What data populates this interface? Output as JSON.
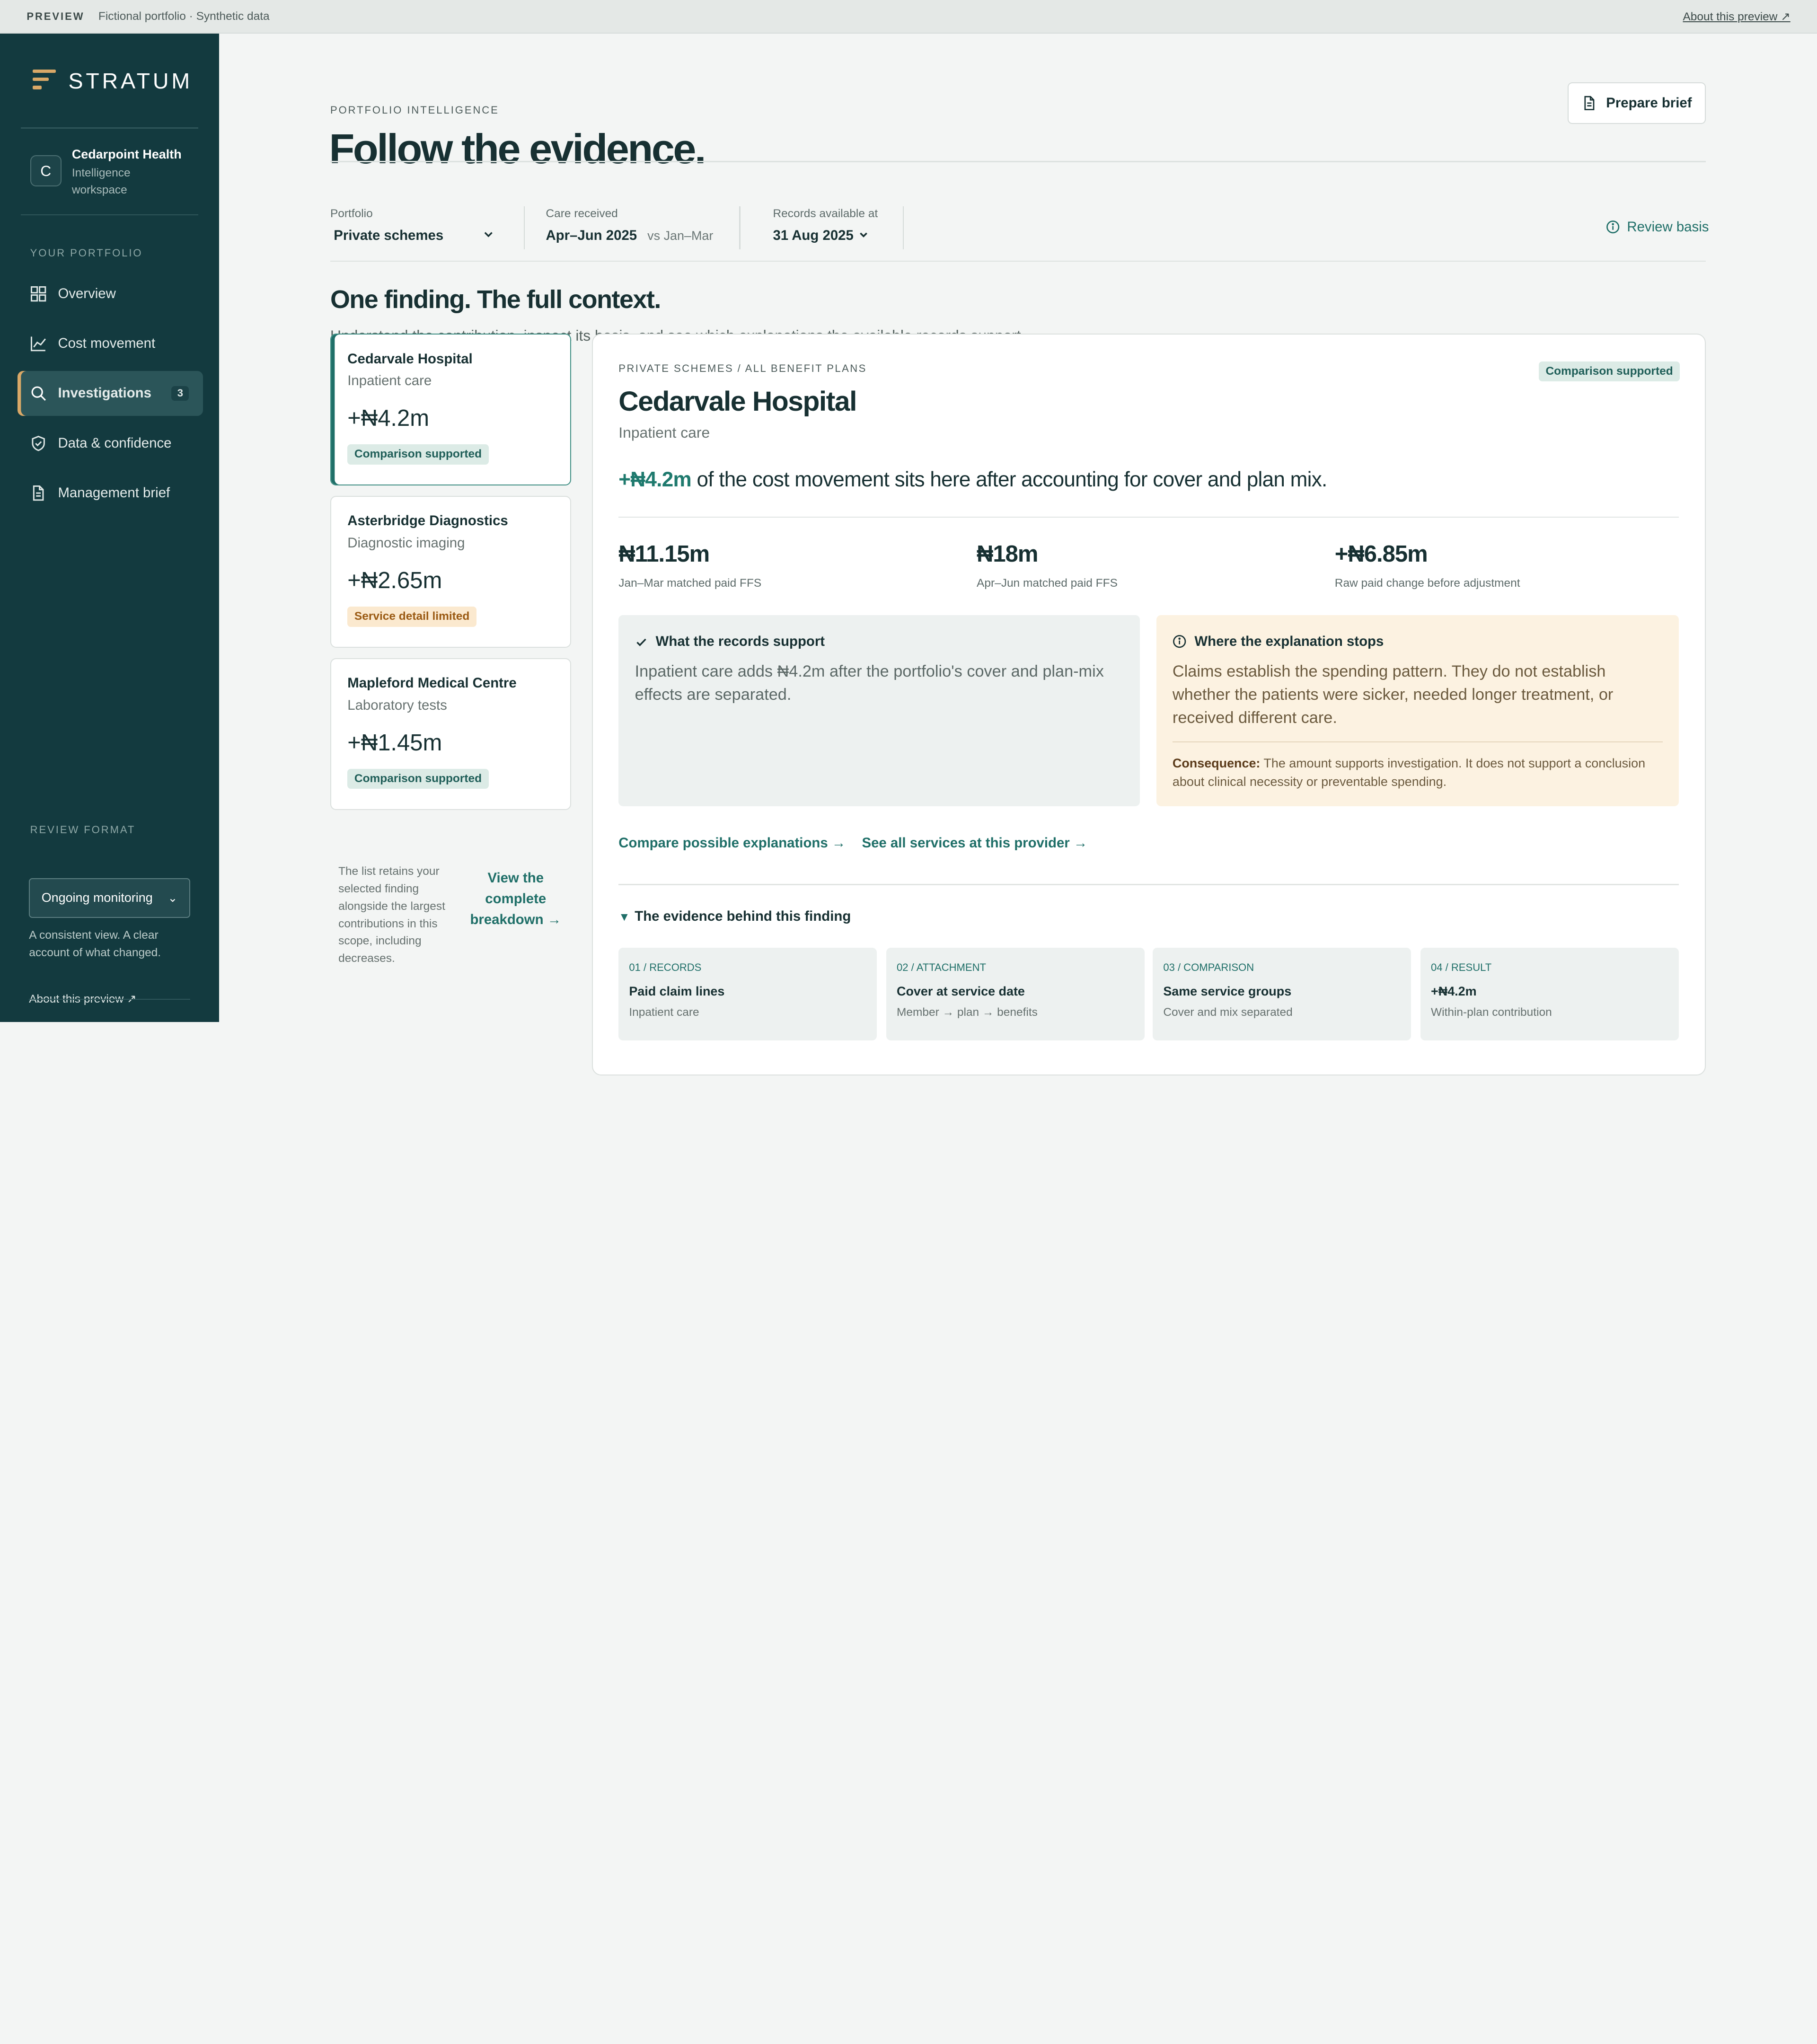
{
  "topbar": {
    "preview": "PREVIEW",
    "note": "Fictional portfolio · Synthetic data",
    "about": "About this preview ↗"
  },
  "sidebar": {
    "logo": "STRATUM",
    "workspace": {
      "initial": "C",
      "name": "Cedarpoint Health",
      "sub": "Intelligence workspace"
    },
    "section_label": "YOUR PORTFOLIO",
    "items": [
      {
        "label": "Overview",
        "icon": "grid-icon"
      },
      {
        "label": "Cost movement",
        "icon": "line-chart-icon"
      },
      {
        "label": "Investigations",
        "icon": "search-icon",
        "count": "3",
        "active": true
      },
      {
        "label": "Data & confidence",
        "icon": "shield-check-icon"
      },
      {
        "label": "Management brief",
        "icon": "document-icon"
      }
    ],
    "review_label": "REVIEW FORMAT",
    "review_value": "Ongoing monitoring",
    "review_desc": "A consistent view. A clear account of what changed.",
    "about": "About this preview ↗"
  },
  "header": {
    "eyebrow": "PORTFOLIO INTELLIGENCE",
    "title": "Follow the evidence.",
    "prepare_brief": "Prepare brief"
  },
  "filters": {
    "portfolio": {
      "label": "Portfolio",
      "value": "Private schemes"
    },
    "care": {
      "label": "Care received",
      "value": "Apr–Jun 2025",
      "compare": "vs Jan–Mar"
    },
    "records": {
      "label": "Records available at",
      "value": "31 Aug 2025"
    },
    "review_basis": "Review basis"
  },
  "section": {
    "title": "One finding. The full context.",
    "lede": "Understand the contribution, inspect its basis, and see which explanations the available records support."
  },
  "findings": [
    {
      "provider": "Cedarvale Hospital",
      "service": "Inpatient care",
      "amount": "+₦4.2m",
      "badge": "Comparison supported",
      "status": "ok",
      "selected": true
    },
    {
      "provider": "Asterbridge Diagnostics",
      "service": "Diagnostic imaging",
      "amount": "+₦2.65m",
      "badge": "Service detail limited",
      "status": "warn"
    },
    {
      "provider": "Mapleford Medical Centre",
      "service": "Laboratory tests",
      "amount": "+₦1.45m",
      "badge": "Comparison supported",
      "status": "ok"
    }
  ],
  "list_note": "The list retains your selected finding alongside the largest contributions in this scope, including decreases.",
  "view_breakdown": "View the complete breakdown →",
  "detail": {
    "eyebrow": "PRIVATE SCHEMES / ALL BENEFIT PLANS",
    "badge": "Comparison supported",
    "title": "Cedarvale Hospital",
    "service": "Inpatient care",
    "finding_amount": "+₦4.2m",
    "finding_text": " of the cost movement sits here after accounting for cover and plan mix.",
    "metrics": [
      {
        "value": "₦11.15m",
        "label": "Jan–Mar matched paid FFS"
      },
      {
        "value": "₦18m",
        "label": "Apr–Jun matched paid FFS"
      },
      {
        "value": "+₦6.85m",
        "label": "Raw paid change before adjustment"
      }
    ],
    "support": {
      "heading": "What the records support",
      "text": "Inpatient care adds ₦4.2m after the portfolio's cover and plan-mix effects are separated."
    },
    "stops": {
      "heading": "Where the explanation stops",
      "text": "Claims establish the spending pattern. They do not establish whether the patients were sicker, needed longer treatment, or received different care.",
      "consequence_label": "Consequence:",
      "consequence_text": " The amount supports investigation. It does not support a conclusion about clinical necessity or preventable spending."
    },
    "links": [
      "Compare possible explanations →",
      "See all services at this provider →"
    ],
    "evidence_toggle": "The evidence behind this finding",
    "steps": [
      {
        "label": "01 / RECORDS",
        "title": "Paid claim lines",
        "sub": "Inpatient care"
      },
      {
        "label": "02 / ATTACHMENT",
        "title": "Cover at service date",
        "sub": "Member → plan → benefits"
      },
      {
        "label": "03 / COMPARISON",
        "title": "Same service groups",
        "sub": "Cover and mix separated"
      },
      {
        "label": "04 / RESULT",
        "title": "+₦4.2m",
        "sub": "Within-plan contribution"
      }
    ]
  },
  "colors": {
    "sidebar": "#133a3f",
    "accent": "#1f6f68",
    "gold": "#d9a867",
    "warn_bg": "#fcf2e1"
  }
}
